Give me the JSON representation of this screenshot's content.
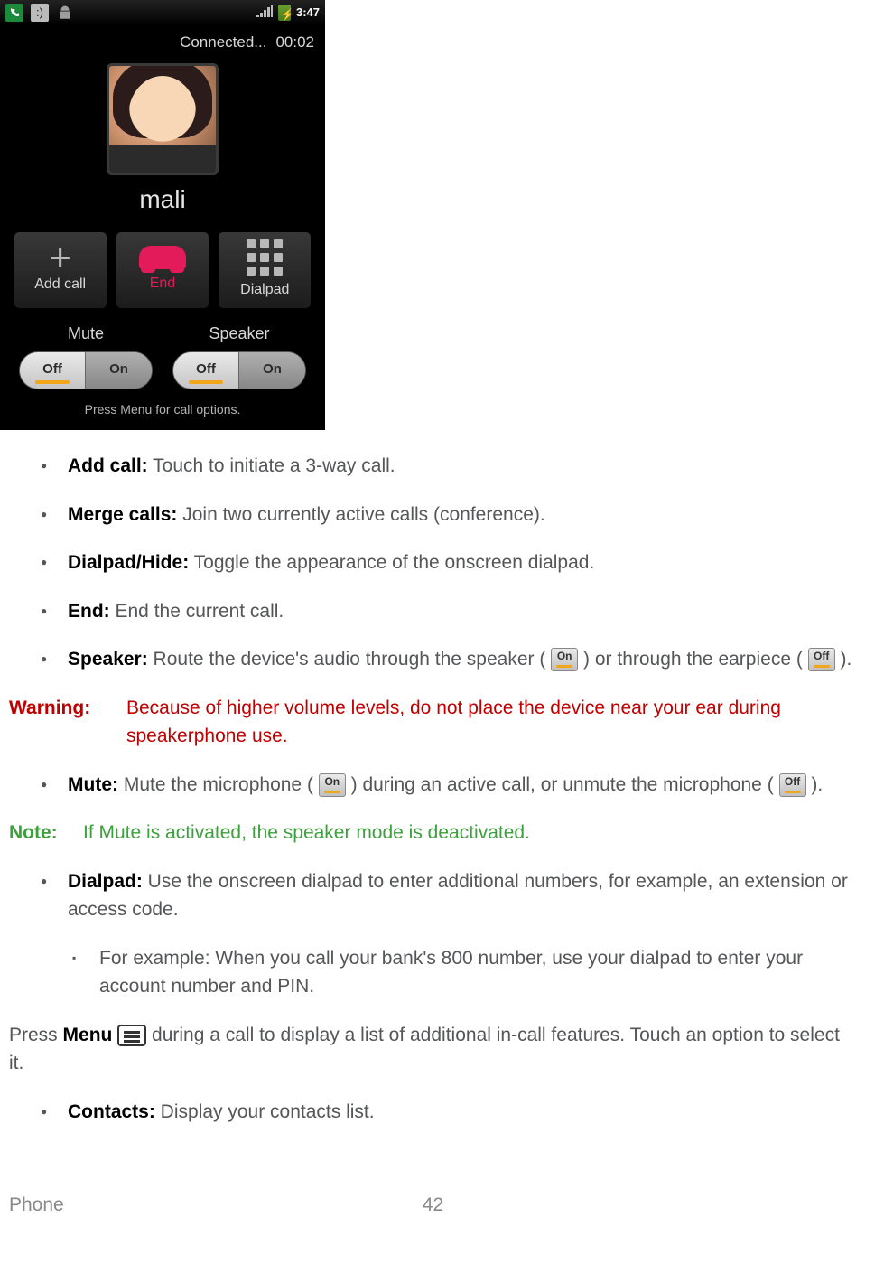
{
  "phone": {
    "status": {
      "time": "3:47"
    },
    "connected": {
      "label": "Connected...",
      "duration": "00:02"
    },
    "contact_name": "mali",
    "buttons": {
      "add_call": "Add call",
      "end": "End",
      "dialpad": "Dialpad"
    },
    "toggles": {
      "mute": {
        "label": "Mute",
        "off": "Off",
        "on": "On"
      },
      "speaker": {
        "label": "Speaker",
        "off": "Off",
        "on": "On"
      }
    },
    "hint": "Press Menu for call options."
  },
  "list": {
    "add_call": {
      "title": "Add call:",
      "desc": " Touch to initiate a 3-way call."
    },
    "merge_calls": {
      "title": "Merge calls:",
      "desc": " Join two currently active calls (conference)."
    },
    "dialpad_hide": {
      "title": "Dialpad/Hide:",
      "desc": " Toggle the appearance of the onscreen dialpad."
    },
    "end": {
      "title": "End:",
      "desc": " End the current call."
    },
    "speaker": {
      "title": "Speaker:",
      "desc_a": " Route the device's audio through the speaker ( ",
      "icon_on": "On",
      "desc_b": " ) or through the earpiece ( ",
      "icon_off": "Off",
      "desc_c": " )."
    },
    "mute": {
      "title": "Mute:",
      "desc_a": " Mute the microphone ( ",
      "icon_on": "On",
      "desc_b": " ) during an active call, or unmute the microphone ( ",
      "icon_off": "Off",
      "desc_c": " )."
    },
    "dialpad": {
      "title": "Dialpad:",
      "desc": " Use the onscreen dialpad to enter additional numbers, for example, an extension or access code."
    },
    "dialpad_sub": "For example: When you call your bank's 800 number, use your dialpad to enter your account number and PIN.",
    "contacts": {
      "title": "Contacts:",
      "desc": " Display your contacts list."
    }
  },
  "warning": {
    "label": "Warning:",
    "text": "Because of higher volume levels, do not place the device near your ear during speakerphone use."
  },
  "note": {
    "label": "Note:",
    "text": "If Mute is activated, the speaker mode is deactivated."
  },
  "menu_para": {
    "a": "Press ",
    "b": "Menu",
    "c": " during a call to display a list of additional in-call features. Touch an option to select it."
  },
  "footer": {
    "section": "Phone",
    "page": "42"
  }
}
